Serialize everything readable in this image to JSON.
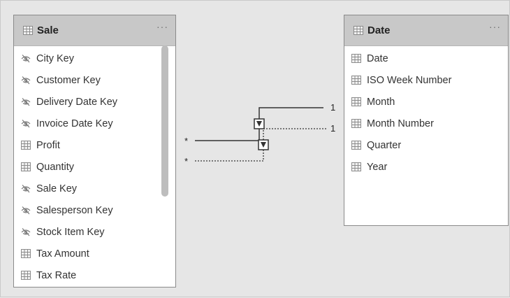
{
  "tables": {
    "sale": {
      "title": "Sale",
      "more_label": "···",
      "fields": [
        {
          "label": "City Key",
          "icon": "hidden-eye-icon"
        },
        {
          "label": "Customer Key",
          "icon": "hidden-eye-icon"
        },
        {
          "label": "Delivery Date Key",
          "icon": "hidden-eye-icon"
        },
        {
          "label": "Invoice Date Key",
          "icon": "hidden-eye-icon"
        },
        {
          "label": "Profit",
          "icon": "table-column-icon"
        },
        {
          "label": "Quantity",
          "icon": "table-column-icon"
        },
        {
          "label": "Sale Key",
          "icon": "hidden-eye-icon"
        },
        {
          "label": "Salesperson Key",
          "icon": "hidden-eye-icon"
        },
        {
          "label": "Stock Item Key",
          "icon": "hidden-eye-icon"
        },
        {
          "label": "Tax Amount",
          "icon": "table-column-icon"
        },
        {
          "label": "Tax Rate",
          "icon": "table-column-icon"
        }
      ]
    },
    "date": {
      "title": "Date",
      "more_label": "···",
      "fields": [
        {
          "label": "Date",
          "icon": "table-column-icon"
        },
        {
          "label": "ISO Week Number",
          "icon": "table-column-icon"
        },
        {
          "label": "Month",
          "icon": "table-column-icon"
        },
        {
          "label": "Month Number",
          "icon": "table-column-icon"
        },
        {
          "label": "Quarter",
          "icon": "table-column-icon"
        },
        {
          "label": "Year",
          "icon": "table-column-icon"
        }
      ]
    }
  },
  "relationships": {
    "active": {
      "from_cardinality": "*",
      "to_cardinality": "1",
      "style": "solid"
    },
    "inactive": {
      "from_cardinality": "*",
      "to_cardinality": "1",
      "style": "dashed"
    }
  },
  "colors": {
    "header_bg": "#c8c8c8",
    "card_bg": "#ffffff",
    "canvas_bg": "#e6e6e6",
    "line": "#333333"
  }
}
